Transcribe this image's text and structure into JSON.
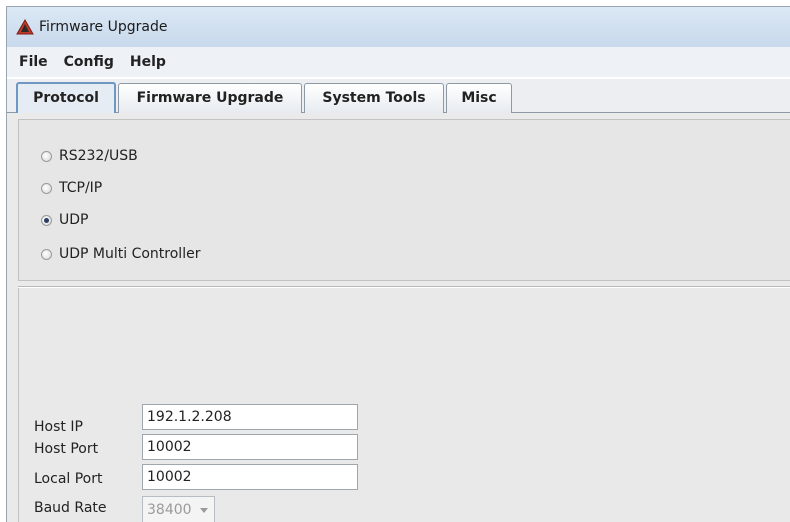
{
  "window": {
    "title": "Firmware Upgrade",
    "icon": "warning-triangle-icon"
  },
  "menubar": {
    "items": [
      "File",
      "Config",
      "Help"
    ]
  },
  "tabs": [
    {
      "label": "Protocol",
      "active": true
    },
    {
      "label": "Firmware Upgrade",
      "active": false
    },
    {
      "label": "System Tools",
      "active": false
    },
    {
      "label": "Misc",
      "active": false
    }
  ],
  "protocol": {
    "options": [
      "RS232/USB",
      "TCP/IP",
      "UDP",
      "UDP Multi Controller"
    ],
    "selected": "UDP"
  },
  "settings": {
    "host_ip_label": "Host IP",
    "host_ip_value": "192.1.2.208",
    "host_port_label": "Host Port",
    "host_port_value": "10002",
    "local_port_label": "Local Port",
    "local_port_value": "10002",
    "baud_rate_label": "Baud Rate",
    "baud_rate_value": "38400"
  },
  "colors": {
    "titlebar": "#c8d9ec",
    "active_tab_border": "#6e97c2"
  }
}
